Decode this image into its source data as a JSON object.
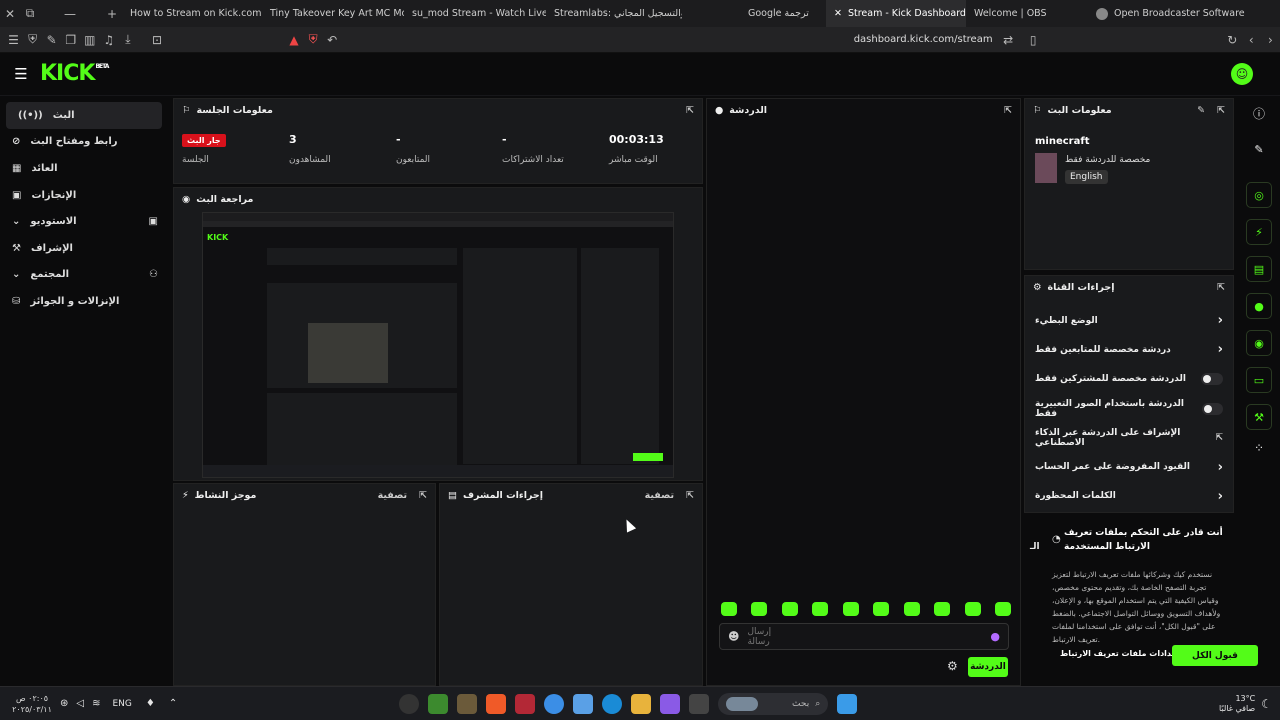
{
  "browser": {
    "tabs": [
      {
        "title": "How to Stream on Kick.com | K",
        "icon_color": "#53fc18"
      },
      {
        "title": "Tiny Takeover Key Art MC Mon",
        "icon_color": "#53fc18"
      },
      {
        "title": "su_mod Stream - Watch Live o",
        "icon_color": "#53fc18"
      },
      {
        "title": "Streamlabs: والتسجيل المجاني",
        "icon_color": "#53fc18"
      },
      {
        "title": "Google ترجمة",
        "icon_color": "#4a7df0"
      },
      {
        "title": "Stream - Kick Dashboard",
        "icon_color": "#53fc18"
      },
      {
        "title": "Welcome | OBS",
        "icon_color": "#888888"
      },
      {
        "title": "Open Broadcaster Software | O",
        "icon_color": "#888888"
      }
    ],
    "url": "dashboard.kick.com/stream"
  },
  "header": {
    "logo": "KICK",
    "logo_badge": "BETA"
  },
  "sidebar": {
    "items": [
      {
        "label": "البث",
        "icon": "broadcast-icon"
      },
      {
        "label": "رابط ومفتاح البث",
        "icon": "link-icon"
      },
      {
        "label": "العائد",
        "icon": "chart-icon"
      },
      {
        "label": "الإنجازات",
        "icon": "trophy-icon"
      },
      {
        "label": "الاستوديو",
        "icon": "studio-icon"
      },
      {
        "label": "الإشراف",
        "icon": "hammer-icon"
      },
      {
        "label": "المجتمع",
        "icon": "community-icon"
      },
      {
        "label": "الإنزالات و الجوائز",
        "icon": "drops-icon"
      }
    ]
  },
  "session": {
    "title": "معلومات الجلسة",
    "live_badge": "جار البث",
    "live_label": "الجلسة",
    "stats": [
      {
        "value": "3",
        "label": "المشاهدون"
      },
      {
        "value": "-",
        "label": "المتابعون"
      },
      {
        "value": "-",
        "label": "تعداد الاشتراكات"
      },
      {
        "value": "00:03:13",
        "label": "الوقت مباشر"
      }
    ]
  },
  "preview": {
    "title": "مراجعة البث"
  },
  "activity": {
    "title": "موجز النشاط",
    "filter_label": "تصفية"
  },
  "mod_actions": {
    "title": "إجراءات المشرف",
    "filter_label": "تصفية"
  },
  "chat": {
    "title": "الدردشة",
    "input_placeholder": "إرسال رسالة",
    "send_label": "الدردشة"
  },
  "stream_info": {
    "title": "معلومات البث",
    "category": "minecraft",
    "description": "مخصصة للدردشة فقط",
    "language": "English"
  },
  "channel_actions": {
    "title": "إجراءات القناة",
    "rows": [
      {
        "label": "الوضع البطيء",
        "control": "chevron"
      },
      {
        "label": "دردشة مخصصة للمتابعين فقط",
        "control": "chevron"
      },
      {
        "label": "الدردشة مخصصة للمشتركين فقط",
        "control": "toggle"
      },
      {
        "label": "الدردشة باستخدام الصور التعبيرية فقط",
        "control": "toggle"
      },
      {
        "label": "الإشراف على الدردشة عبر الذكاء الاصطناعي",
        "control": "external"
      },
      {
        "label": "القيود المفروضة على عمر الحساب",
        "control": "chevron"
      },
      {
        "label": "الكلمات المحظورة",
        "control": "chevron"
      }
    ]
  },
  "cookie": {
    "title": "أنت قادر على التحكم بملفات تعريف الارتباط المستخدمة",
    "body": "نستخدم كيك وشركائها ملفات تعريف الارتباط لتعزيز تجربة التصفح الخاصة بك، وتقديم محتوى مخصص، وقياس الكيفية التي يتم استخدام الموقع بها، و الإعلان، ولأهداف التسويق ووسائل التواصل الاجتماعي. بالضغط على \"قبول الكل\"، أنت توافق على استخدامنا لملفات تعريف الارتباط.",
    "settings_label": "إعدادات ملفات تعريف الارتباط",
    "accept_label": "قبول الكل",
    "partial": "الـ"
  },
  "taskbar": {
    "time": "٠٢:٠٥ ص",
    "date": "٢٠٢٥/٠٣/١١",
    "lang": "ENG",
    "search_placeholder": "بحث",
    "weather_temp": "13°C",
    "weather_desc": "صافي غالبًا"
  },
  "colors": {
    "accent": "#53fc18",
    "live": "#d8111b",
    "panel": "#191a1c"
  }
}
